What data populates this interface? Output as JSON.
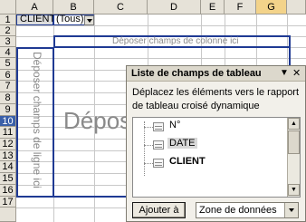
{
  "sheet": {
    "columns": [
      "A",
      "B",
      "C",
      "D",
      "E",
      "F",
      "G"
    ],
    "rows": [
      "1",
      "2",
      "3",
      "4",
      "5",
      "6",
      "7",
      "8",
      "9",
      "10",
      "11",
      "12",
      "13",
      "14",
      "15",
      "16",
      "17"
    ],
    "cell_a1": "CLIENT",
    "cell_b1": "(Tous)"
  },
  "pivot_dropzones": {
    "column_zone_text": "Déposer champs de colonne ici",
    "row_zone_text": "Déposer champs de ligne ici",
    "data_zone_text": "Dépos"
  },
  "field_list_panel": {
    "title": "Liste de champs de tableau",
    "description": "Déplacez les éléments vers le rapport de tableau croisé dynamique",
    "fields": [
      {
        "label": "N°"
      },
      {
        "label": "DATE"
      },
      {
        "label": "CLIENT"
      }
    ],
    "add_button_label": "Ajouter à",
    "area_select_value": "Zone de données"
  }
}
